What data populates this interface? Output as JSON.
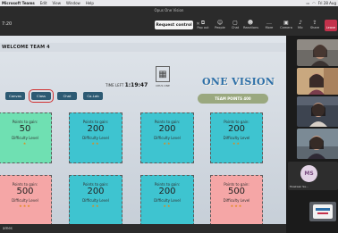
{
  "menubar": {
    "app_name": "Microsoft Teams",
    "items": [
      "Edit",
      "View",
      "Window",
      "Help"
    ],
    "clock": "Fri 28 Aug"
  },
  "toolbar": {
    "window_title": "Opus One Vision",
    "timer": "7:20",
    "request_control": "Request control",
    "buttons": [
      "Pop out",
      "People",
      "Chat",
      "Reactions",
      "More",
      "Camera",
      "Mic",
      "Share",
      "Leave"
    ]
  },
  "board": {
    "team_title": "WELCOME TEAM 4",
    "time_left_label": "TIME LEFT",
    "time_left_value": "1:19:47",
    "logo_caption": "OPUS ONE",
    "brand_text": "ONE VISION",
    "tabs": [
      "Canvas",
      "Class",
      "Chat",
      "Co-Lab"
    ],
    "team_points": "TEAM POINTS 400",
    "cards": [
      {
        "points_text": "Points to gain:",
        "points": "50",
        "difficulty_text": "Difficulty Level",
        "stars": "★"
      },
      {
        "points_text": "Points to gain:",
        "points": "200",
        "difficulty_text": "Difficulty Level",
        "stars": "★★"
      },
      {
        "points_text": "Points to gain:",
        "points": "200",
        "difficulty_text": "Difficulty Level",
        "stars": "★★"
      },
      {
        "points_text": "Points to gain:",
        "points": "200",
        "difficulty_text": "Difficulty Level",
        "stars": "★★"
      },
      {
        "points_text": "Points to gain:",
        "points": "500",
        "difficulty_text": "Difficulty Level",
        "stars": "★★★"
      },
      {
        "points_text": "Points to gain:",
        "points": "200",
        "difficulty_text": "Difficulty Level",
        "stars": "★★"
      },
      {
        "points_text": "Points to gain:",
        "points": "200",
        "difficulty_text": "Difficulty Level",
        "stars": "★★"
      },
      {
        "points_text": "Points to gain:",
        "points": "500",
        "difficulty_text": "Difficulty Level",
        "stars": "★★★"
      }
    ]
  },
  "status_text": "ames",
  "participants": {
    "ms_initials": "MS",
    "ms_name": "Muskaan Sa..."
  },
  "colors": {
    "card_green": "#6fe0b2",
    "card_teal": "#3ec4d0",
    "card_pink": "#f5a6a6",
    "tab_blue": "#2d5a73",
    "leave_red": "#c4314b",
    "brand_blue": "#2d6fa8"
  }
}
